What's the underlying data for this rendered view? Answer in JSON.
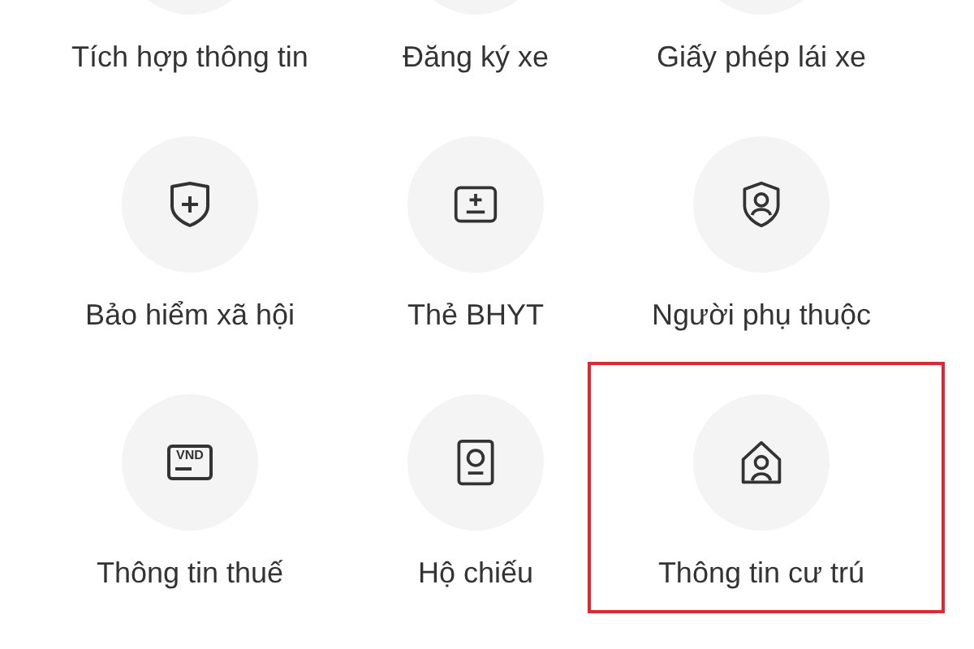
{
  "services": [
    {
      "label": "Tích hợp thông tin",
      "highlighted": false
    },
    {
      "label": "Đăng ký xe",
      "highlighted": false
    },
    {
      "label": "Giấy phép lái xe",
      "highlighted": false
    },
    {
      "label": "Bảo hiểm xã hội",
      "kind": "shield-plus",
      "highlighted": false
    },
    {
      "label": "Thẻ BHYT",
      "kind": "card",
      "highlighted": false
    },
    {
      "label": "Người phụ thuộc",
      "kind": "shield-person",
      "highlighted": false
    },
    {
      "label": "Thông tin thuế",
      "kind": "banknote",
      "icon_text": "VND",
      "highlighted": false
    },
    {
      "label": "Hộ chiếu",
      "kind": "passport",
      "highlighted": false
    },
    {
      "label": "Thông tin cư trú",
      "kind": "house",
      "highlighted": true
    }
  ]
}
